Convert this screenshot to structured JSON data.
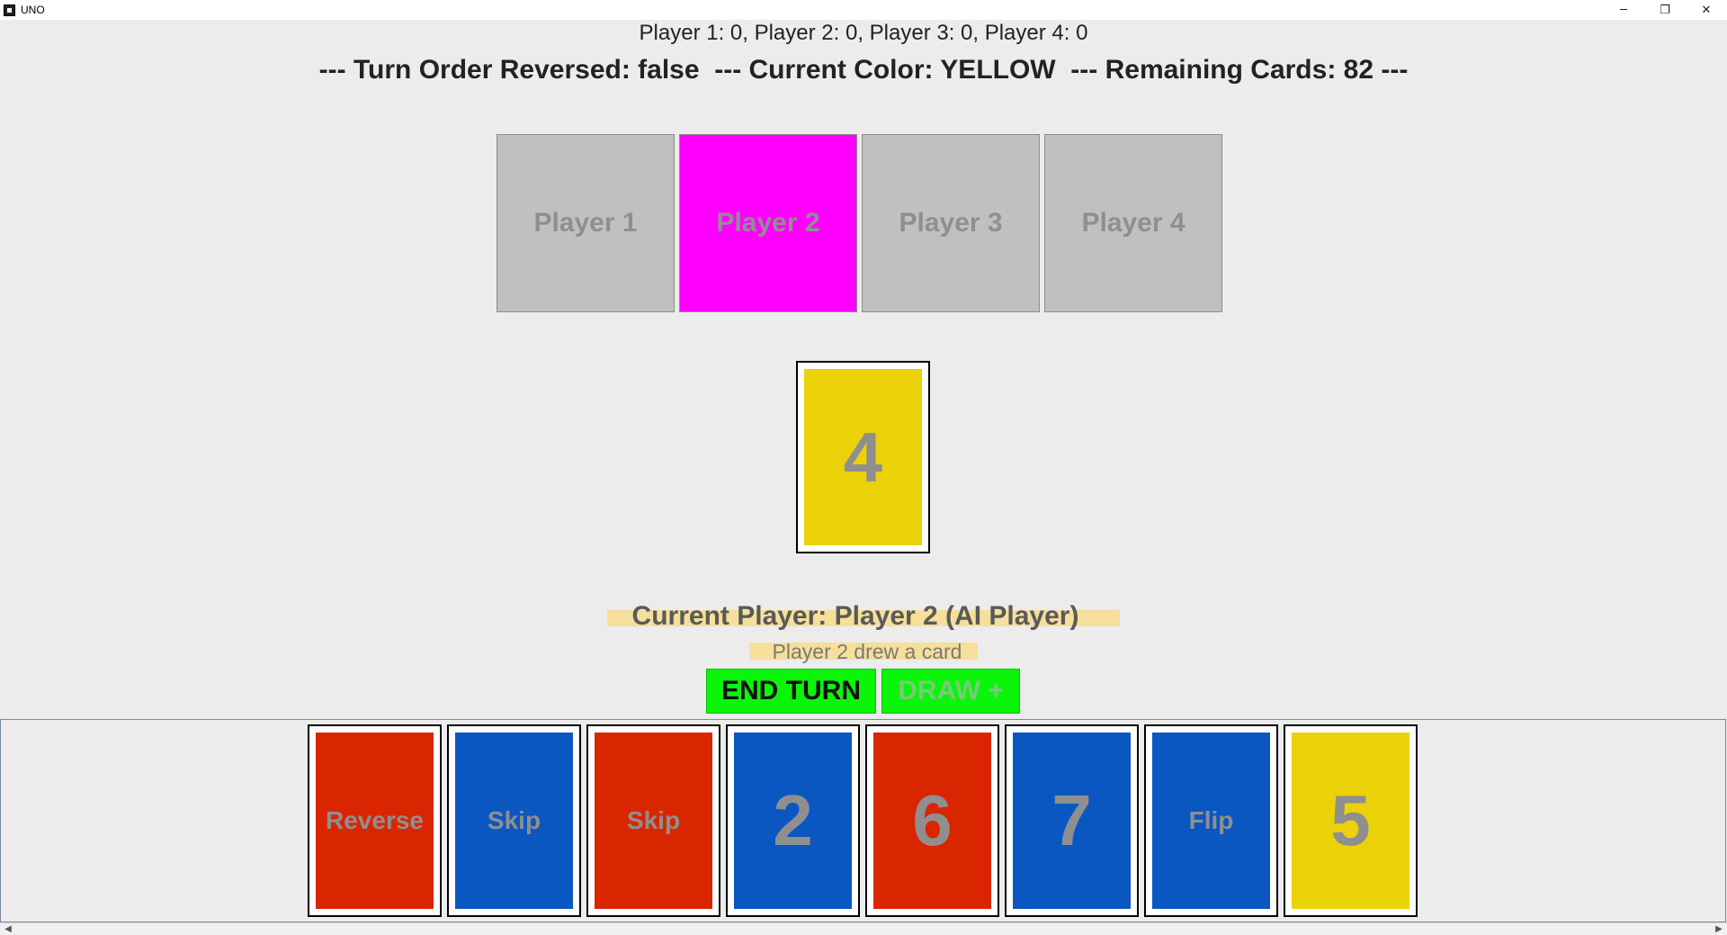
{
  "window": {
    "title": "UNO",
    "minimize_glyph": "─",
    "maximize_glyph": "❐",
    "close_glyph": "✕"
  },
  "scores": "Player 1: 0, Player 2: 0, Player 3: 0, Player 4: 0",
  "status": "--- Turn Order Reversed: false  --- Current Color: YELLOW  --- Remaining Cards: 82 ---",
  "players": [
    {
      "label": "Player 1",
      "color": "#c0c0c0"
    },
    {
      "label": "Player 2",
      "color": "#ff00ff"
    },
    {
      "label": "Player 3",
      "color": "#c0c0c0"
    },
    {
      "label": "Player 4",
      "color": "#c0c0c0"
    }
  ],
  "discard": {
    "value": "4",
    "color": "#ebd208"
  },
  "current_player": "Current Player: Player 2 (AI Player)",
  "message": "Player 2 drew a card",
  "buttons": {
    "end_turn": "END TURN",
    "draw": "DRAW +"
  },
  "hand": [
    {
      "value": "Reverse",
      "color": "#d92600",
      "big": false
    },
    {
      "value": "Skip",
      "color": "#0b57c2",
      "big": false
    },
    {
      "value": "Skip",
      "color": "#d92600",
      "big": false
    },
    {
      "value": "2",
      "color": "#0b57c2",
      "big": true
    },
    {
      "value": "6",
      "color": "#d92600",
      "big": true
    },
    {
      "value": "7",
      "color": "#0b57c2",
      "big": true
    },
    {
      "value": "Flip",
      "color": "#0b57c2",
      "big": false
    },
    {
      "value": "5",
      "color": "#ebd208",
      "big": true
    }
  ],
  "scrollbar": {
    "left_glyph": "◀",
    "right_glyph": "▶"
  }
}
